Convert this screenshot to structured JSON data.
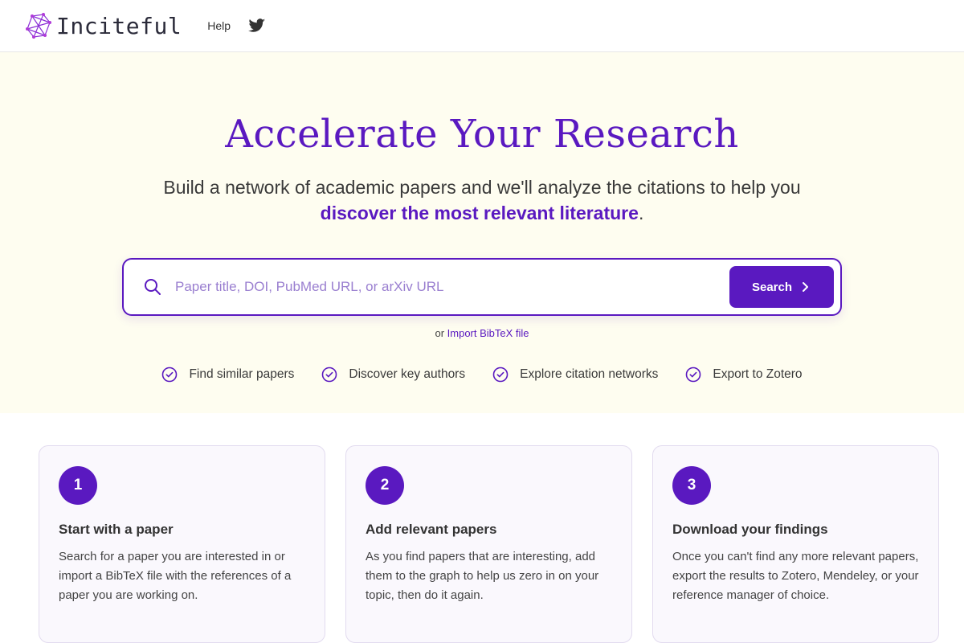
{
  "header": {
    "brand": "Inciteful",
    "help_label": "Help",
    "logo_icon": "network-logo-icon",
    "twitter_icon": "twitter-icon"
  },
  "hero": {
    "title": "Accelerate Your Research",
    "subtitle_part1": "Build a network of academic papers and we'll analyze the citations to help you ",
    "subtitle_emphasis": "discover the most relevant literature",
    "subtitle_end": "."
  },
  "search": {
    "placeholder": "Paper title, DOI, PubMed URL, or arXiv URL",
    "value": "",
    "button_label": "Search"
  },
  "import": {
    "prefix": "or",
    "link_label": "Import BibTeX file"
  },
  "features": [
    {
      "label": "Find similar papers"
    },
    {
      "label": "Discover key authors"
    },
    {
      "label": "Explore citation networks"
    },
    {
      "label": "Export to Zotero"
    }
  ],
  "steps": [
    {
      "number": "1",
      "title": "Start with a paper",
      "text": "Search for a paper you are interested in or import a BibTeX file with the references of a paper you are working on."
    },
    {
      "number": "2",
      "title": "Add relevant papers",
      "text": "As you find papers that are interesting, add them to the graph to help us zero in on your topic, then do it again."
    },
    {
      "number": "3",
      "title": "Download your findings",
      "text": "Once you can't find any more relevant papers, export the results to Zotero, Mendeley, or your reference manager of choice."
    }
  ],
  "colors": {
    "accent": "#5a19c0",
    "hero_background": "#fefdf0",
    "card_background": "#faf8fd"
  }
}
